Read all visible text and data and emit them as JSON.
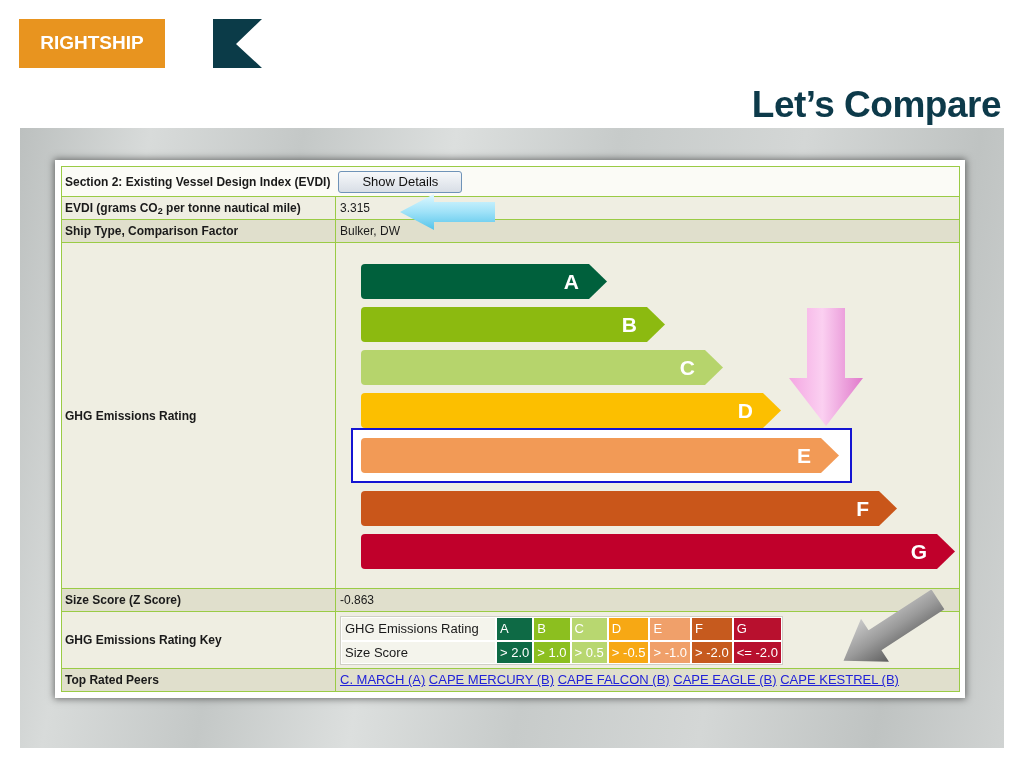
{
  "header": {
    "logo_text": "RIGHTSHIP",
    "title": "Let’s Compare"
  },
  "evdi_table": {
    "section_title": "Section 2: Existing Vessel Design Index (EVDI)",
    "details_button": "Show Details",
    "rows": [
      {
        "kind": "text",
        "label": "EVDI (grams CO$_{2}$ per tonne nautical mile)",
        "value": "3.315"
      },
      {
        "kind": "text",
        "label": "Ship Type, Comparison Factor",
        "value": "Bulker, DW"
      },
      {
        "kind": "rating",
        "label": "GHG Emissions Rating",
        "ratings": [
          {
            "grade": "A",
            "color": "#00603c",
            "selected": false
          },
          {
            "grade": "B",
            "color": "#8cba10",
            "selected": false
          },
          {
            "grade": "C",
            "color": "#b6d46c",
            "selected": false
          },
          {
            "grade": "D",
            "color": "#fcbf00",
            "selected": false
          },
          {
            "grade": "E",
            "color": "#f29a56",
            "selected": true
          },
          {
            "grade": "F",
            "color": "#c9561a",
            "selected": false
          },
          {
            "grade": "G",
            "color": "#c0002b",
            "selected": false
          }
        ]
      },
      {
        "kind": "text",
        "label": "Size Score (Z Score)",
        "value": "-0.863"
      },
      {
        "kind": "key",
        "label": "GHG Emissions Rating Key",
        "rating_label": "GHG Emissions Rating",
        "score_label": "Size Score",
        "columns": [
          {
            "grade": "A",
            "range": "> 2.0",
            "color": "#0e6a45"
          },
          {
            "grade": "B",
            "range": "> 1.0",
            "color": "#8cbf1f"
          },
          {
            "grade": "C",
            "range": "> 0.5",
            "color": "#b8d770"
          },
          {
            "grade": "D",
            "range": "> -0.5",
            "color": "#f7a814"
          },
          {
            "grade": "E",
            "range": "> -1.0",
            "color": "#f0a06a"
          },
          {
            "grade": "F",
            "range": "> -2.0",
            "color": "#c65a1e"
          },
          {
            "grade": "G",
            "range": "<= -2.0",
            "color": "#b8102e"
          }
        ]
      },
      {
        "kind": "links",
        "label": "Top Rated Peers",
        "links": [
          "C. MARCH (A)",
          "CAPE MERCURY (B)",
          "CAPE FALCON (B)",
          "CAPE EAGLE (B)",
          "CAPE KESTREL (B)"
        ]
      }
    ]
  }
}
